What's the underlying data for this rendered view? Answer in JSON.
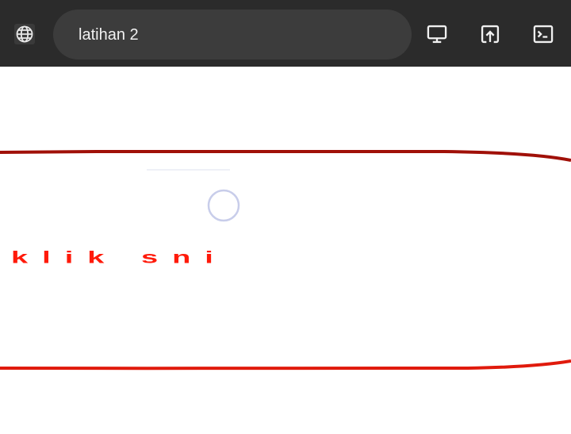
{
  "toolbar": {
    "site_icon": "globe-icon",
    "url_text": "latihan 2",
    "buttons": [
      {
        "name": "desktop-site-button",
        "icon": "monitor-icon"
      },
      {
        "name": "open-in-browser-button",
        "icon": "open-external-icon"
      },
      {
        "name": "console-button",
        "icon": "terminal-icon"
      }
    ]
  },
  "page": {
    "button_text": "klik sni",
    "colors": {
      "border_top": "#a01008",
      "border_bottom": "#e01a0c",
      "text": "#ff1a0a",
      "spinner": "#c8cdea"
    }
  }
}
